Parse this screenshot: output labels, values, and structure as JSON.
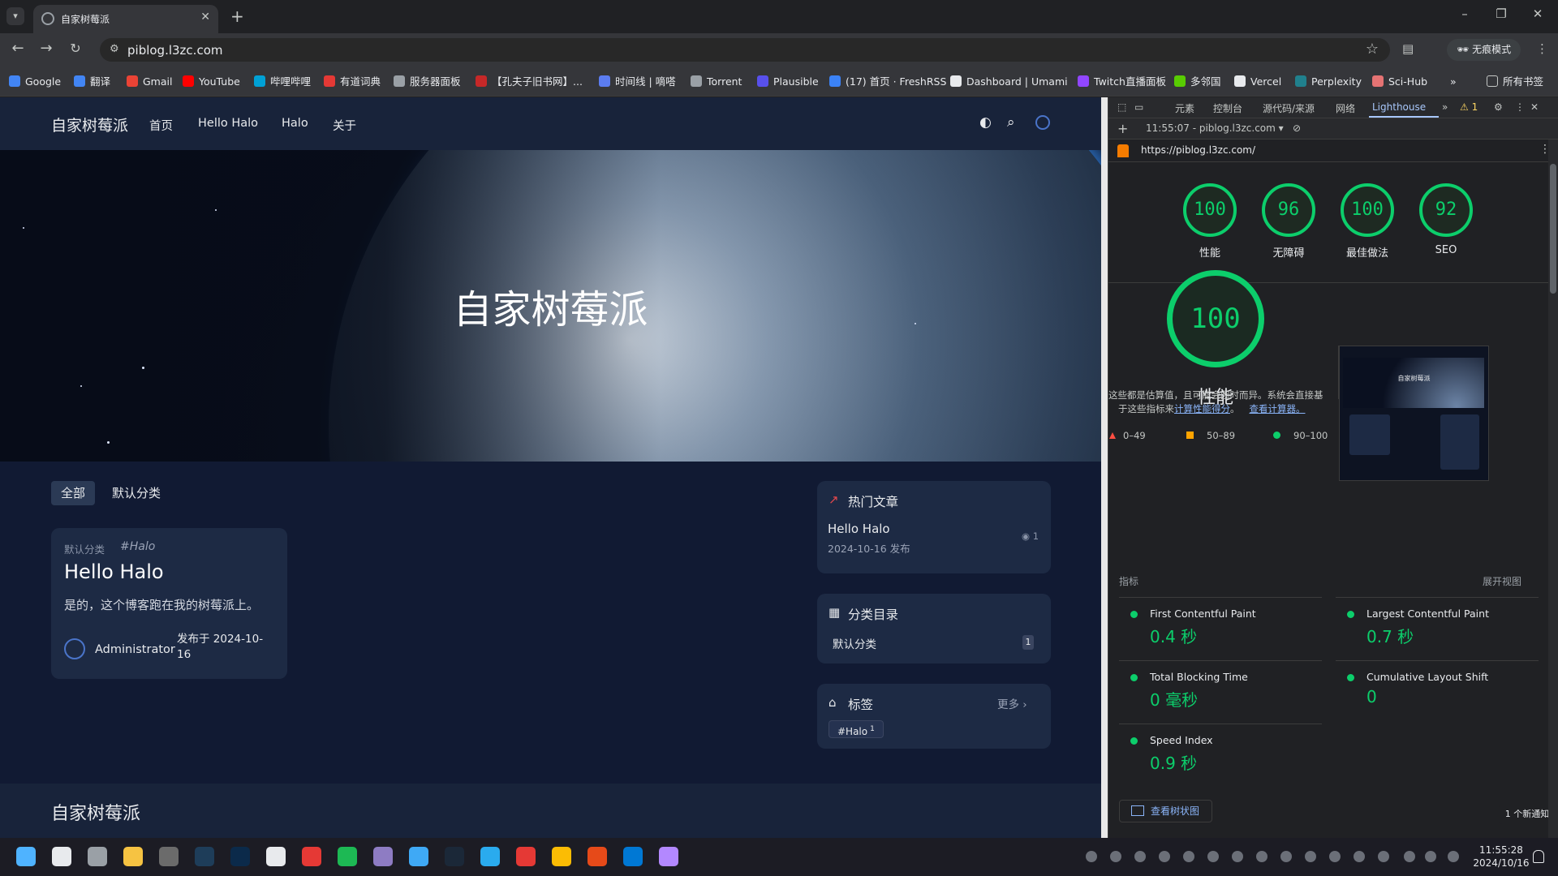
{
  "browser": {
    "tab_title": "自家树莓派",
    "url": "piblog.l3zc.com",
    "incognito_label": "无痕模式",
    "bookmarks": [
      {
        "label": "Google",
        "color": "#4285f4"
      },
      {
        "label": "翻译",
        "color": "#4285f4"
      },
      {
        "label": "Gmail",
        "color": "#ea4335"
      },
      {
        "label": "YouTube",
        "color": "#ff0000"
      },
      {
        "label": "哔哩哔哩",
        "color": "#00a1d6"
      },
      {
        "label": "有道词典",
        "color": "#e53935"
      },
      {
        "label": "服务器面板",
        "color": "#9aa0a6"
      },
      {
        "label": "【孔夫子旧书网】...",
        "color": "#c62828"
      },
      {
        "label": "时间线 | 嘀嗒",
        "color": "#5b7cf0"
      },
      {
        "label": "Torrent",
        "color": "#9aa0a6"
      },
      {
        "label": "Plausible",
        "color": "#5850ec"
      },
      {
        "label": "(17) 首页 · FreshRSS",
        "color": "#3b82f6"
      },
      {
        "label": "Dashboard | Umami",
        "color": "#e8eaed"
      },
      {
        "label": "Twitch直播面板",
        "color": "#9146ff"
      },
      {
        "label": "多邻国",
        "color": "#58cc02"
      },
      {
        "label": "Vercel",
        "color": "#e8eaed"
      },
      {
        "label": "Perplexity",
        "color": "#20808d"
      },
      {
        "label": "Sci-Hub",
        "color": "#e57373"
      }
    ],
    "all_bookmarks_label": "所有书签"
  },
  "site": {
    "brand": "自家树莓派",
    "nav": [
      "首页",
      "Hello Halo",
      "Halo",
      "关于"
    ],
    "hero_title": "自家树莓派",
    "category_tabs": [
      "全部",
      "默认分类"
    ],
    "post": {
      "category": "默认分类",
      "tag": "#Halo",
      "title": "Hello Halo",
      "excerpt": "是的，这个博客跑在我的树莓派上。",
      "author": "Administrator",
      "date": "发布于 2024-10-16"
    },
    "hot": {
      "title": "热门文章",
      "item_title": "Hello Halo",
      "item_date": "2024-10-16 发布",
      "views": "1"
    },
    "categories": {
      "title": "分类目录",
      "item": "默认分类",
      "count": "1"
    },
    "tags": {
      "title": "标签",
      "more": "更多",
      "tag": "#Halo",
      "tag_count": "1"
    },
    "footer_brand": "自家树莓派"
  },
  "devtools": {
    "tabs": [
      "元素",
      "控制台",
      "源代码/来源",
      "网络",
      "Lighthouse"
    ],
    "warnings": "1",
    "report_time": "11:55:07 - piblog.l3zc.com",
    "report_url": "https://piblog.l3zc.com/",
    "scores": [
      {
        "value": "100",
        "label": "性能"
      },
      {
        "value": "96",
        "label": "无障碍"
      },
      {
        "value": "100",
        "label": "最佳做法"
      },
      {
        "value": "92",
        "label": "SEO"
      }
    ],
    "perf_score": "100",
    "perf_label": "性能",
    "perf_note_1": "这些都是估算值，且可能会因时而异。系统会直接基",
    "perf_note_2": "于这些指标来",
    "perf_link_1": "计算性能得分",
    "perf_link_2": "查看计算器。",
    "legend": [
      "0–49",
      "50–89",
      "90–100"
    ],
    "metrics_label": "指标",
    "expand_label": "展开视图",
    "metrics": [
      {
        "name": "First Contentful Paint",
        "value": "0.4 秒"
      },
      {
        "name": "Largest Contentful Paint",
        "value": "0.7 秒"
      },
      {
        "name": "Total Blocking Time",
        "value": "0 毫秒"
      },
      {
        "name": "Cumulative Layout Shift",
        "value": "0"
      },
      {
        "name": "Speed Index",
        "value": "0.9 秒"
      }
    ],
    "treemap_button": "查看树状图",
    "notification": "1 个新通知",
    "thumb_title": "自家树莓派"
  },
  "taskbar": {
    "time": "11:55:28",
    "date": "2024/10/16"
  },
  "colors": {
    "pass": "#0cce6b",
    "average": "#ffa400",
    "fail": "#ff4e42",
    "page_bg": "#111a33",
    "card_bg": "#1d2a44"
  }
}
